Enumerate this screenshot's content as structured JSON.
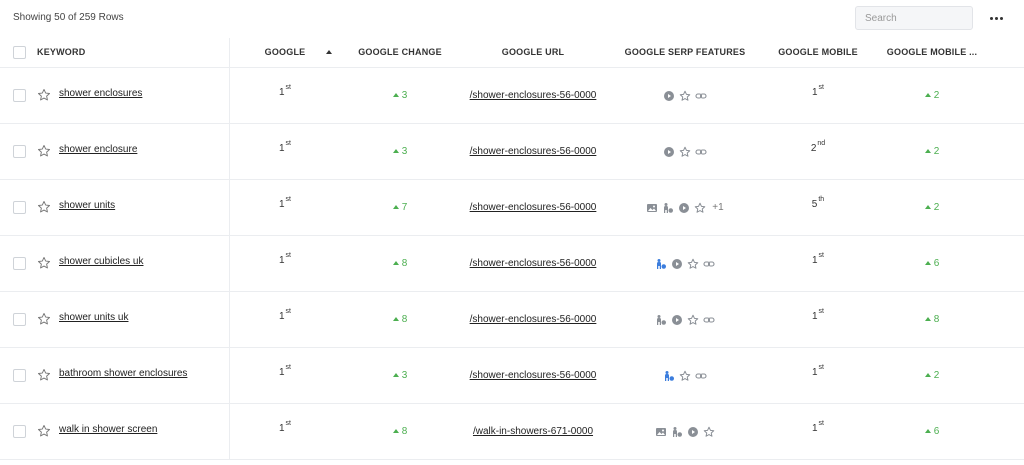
{
  "header": {
    "row_count": "Showing 50 of 259 Rows",
    "search_placeholder": "Search"
  },
  "columns": {
    "keyword": "KEYWORD",
    "google": "GOOGLE",
    "google_change": "GOOGLE CHANGE",
    "google_url": "GOOGLE URL",
    "serp_features": "GOOGLE SERP FEATURES",
    "google_mobile": "GOOGLE MOBILE",
    "google_mobile_change": "GOOGLE MOBILE ..."
  },
  "colors": {
    "positive": "#4caf50",
    "highlight_icon": "#3b7ddd",
    "icon": "#8a8f96"
  },
  "rows": [
    {
      "keyword": "shower enclosures",
      "rank": "1",
      "rank_suffix": "st",
      "change": "3",
      "url": "/shower-enclosures-56-0000",
      "features": [
        "video-icon",
        "star-icon",
        "link-icon"
      ],
      "features_extra": "",
      "mobile_rank": "1",
      "mobile_suffix": "st",
      "mobile_change": "2"
    },
    {
      "keyword": "shower enclosure",
      "rank": "1",
      "rank_suffix": "st",
      "change": "3",
      "url": "/shower-enclosures-56-0000",
      "features": [
        "video-icon",
        "star-icon",
        "link-icon"
      ],
      "features_extra": "",
      "mobile_rank": "2",
      "mobile_suffix": "nd",
      "mobile_change": "2"
    },
    {
      "keyword": "shower units",
      "rank": "1",
      "rank_suffix": "st",
      "change": "7",
      "url": "/shower-enclosures-56-0000",
      "features": [
        "image-icon",
        "people-also-ask-icon",
        "video-icon",
        "star-icon"
      ],
      "features_extra": "+1",
      "mobile_rank": "5",
      "mobile_suffix": "th",
      "mobile_change": "2"
    },
    {
      "keyword": "shower cubicles uk",
      "rank": "1",
      "rank_suffix": "st",
      "change": "8",
      "url": "/shower-enclosures-56-0000",
      "features": [
        "people-also-ask-icon-active",
        "video-icon",
        "star-icon",
        "link-icon"
      ],
      "features_extra": "",
      "mobile_rank": "1",
      "mobile_suffix": "st",
      "mobile_change": "6"
    },
    {
      "keyword": "shower units uk",
      "rank": "1",
      "rank_suffix": "st",
      "change": "8",
      "url": "/shower-enclosures-56-0000",
      "features": [
        "people-also-ask-icon",
        "video-icon",
        "star-icon",
        "link-icon"
      ],
      "features_extra": "",
      "mobile_rank": "1",
      "mobile_suffix": "st",
      "mobile_change": "8"
    },
    {
      "keyword": "bathroom shower enclosures",
      "rank": "1",
      "rank_suffix": "st",
      "change": "3",
      "url": "/shower-enclosures-56-0000",
      "features": [
        "people-also-ask-icon-active",
        "star-icon",
        "link-icon"
      ],
      "features_extra": "",
      "mobile_rank": "1",
      "mobile_suffix": "st",
      "mobile_change": "2"
    },
    {
      "keyword": "walk in shower screen",
      "rank": "1",
      "rank_suffix": "st",
      "change": "8",
      "url": "/walk-in-showers-671-0000",
      "features": [
        "image-icon",
        "people-also-ask-icon",
        "video-icon",
        "star-icon"
      ],
      "features_extra": "",
      "mobile_rank": "1",
      "mobile_suffix": "st",
      "mobile_change": "6"
    }
  ]
}
